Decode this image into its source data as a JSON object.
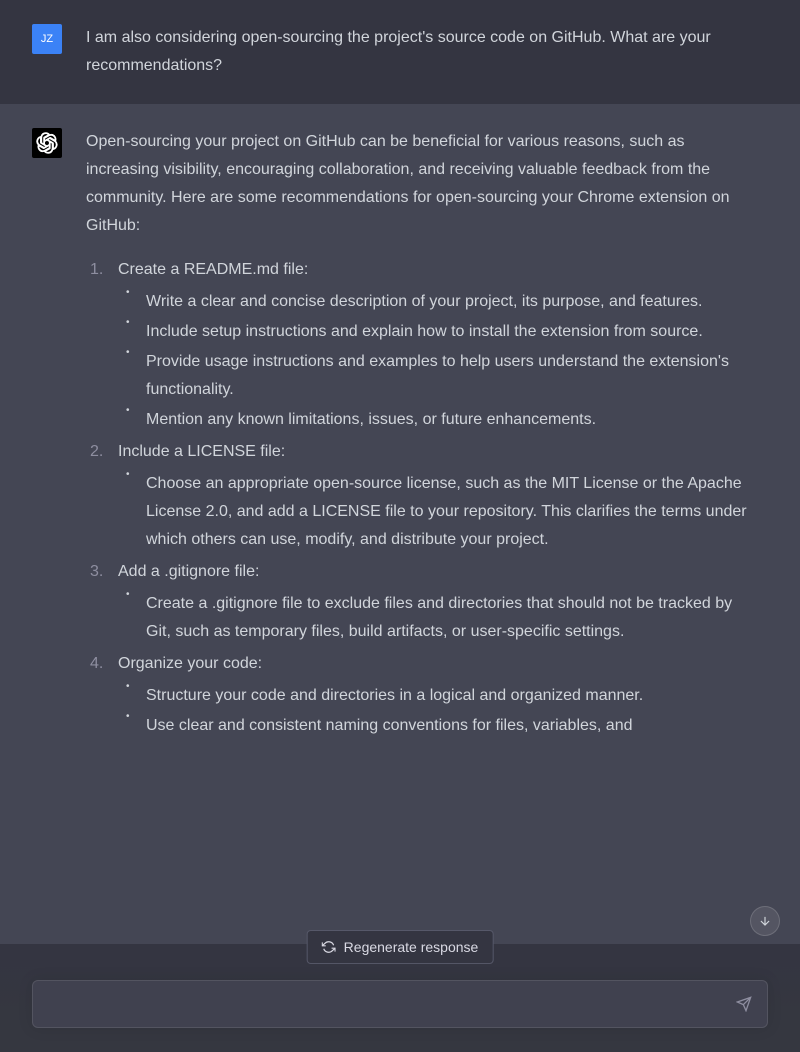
{
  "user": {
    "initials": "JZ",
    "message": "I am also considering open-sourcing the project's source code on GitHub. What are your recommendations?"
  },
  "assistant": {
    "intro": "Open-sourcing your project on GitHub can be beneficial for various reasons, such as increasing visibility, encouraging collaboration, and receiving valuable feedback from the community. Here are some recommendations for open-sourcing your Chrome extension on GitHub:",
    "items": [
      {
        "title": "Create a README.md file:",
        "bullets": [
          "Write a clear and concise description of your project, its purpose, and features.",
          "Include setup instructions and explain how to install the extension from source.",
          "Provide usage instructions and examples to help users understand the extension's functionality.",
          "Mention any known limitations, issues, or future enhancements."
        ]
      },
      {
        "title": "Include a LICENSE file:",
        "bullets": [
          "Choose an appropriate open-source license, such as the MIT License or the Apache License 2.0, and add a LICENSE file to your repository. This clarifies the terms under which others can use, modify, and distribute your project."
        ]
      },
      {
        "title": "Add a .gitignore file:",
        "bullets": [
          "Create a .gitignore file to exclude files and directories that should not be tracked by Git, such as temporary files, build artifacts, or user-specific settings."
        ]
      },
      {
        "title": "Organize your code:",
        "bullets": [
          "Structure your code and directories in a logical and organized manner.",
          "Use clear and consistent naming conventions for files, variables, and"
        ]
      }
    ]
  },
  "controls": {
    "regenerate_label": "Regenerate response",
    "input_placeholder": ""
  }
}
